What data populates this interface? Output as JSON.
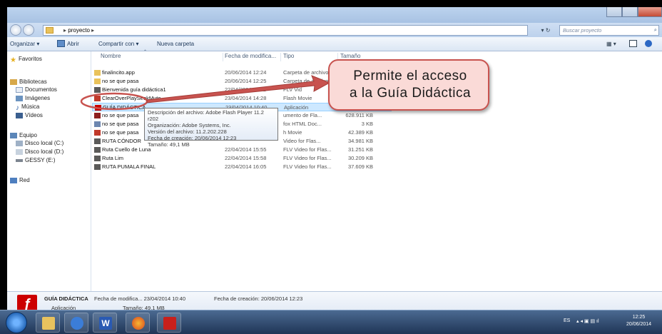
{
  "window": {
    "address_path": [
      "proyecto"
    ],
    "search_placeholder": "Buscar proyecto",
    "toolbar": {
      "organize": "Organizar ▾",
      "open": "Abrir",
      "share": "Compartir con ▾",
      "new_folder": "Nueva carpeta"
    }
  },
  "nav": {
    "favorites": "Favoritos",
    "libraries": "Bibliotecas",
    "documents": "Documentos",
    "images": "Imágenes",
    "music": "Música",
    "videos": "Vídeos",
    "computer": "Equipo",
    "disk_c": "Disco local (C:)",
    "disk_d": "Disco local (D:)",
    "gessy": "GESSY (E:)",
    "network": "Red"
  },
  "columns": {
    "name": "Nombre",
    "date": "Fecha de modifica...",
    "type": "Tipo",
    "size": "Tamaño"
  },
  "files": [
    {
      "name": "finalincito.app",
      "date": "20/06/2014 12:24",
      "type": "Carpeta de archivos",
      "size": "",
      "icon": "folder-icon"
    },
    {
      "name": "no se que pasa",
      "date": "20/06/2014 12:25",
      "type": "Carpeta de archivos",
      "size": "",
      "icon": "folder-icon"
    },
    {
      "name": "Bienvenida guía didáctica1",
      "date": "22/04/2014 11:12",
      "type": "FLV Vid",
      "size": "",
      "icon": "video-file-icon"
    },
    {
      "name": "ClearOverPlaySeekMute",
      "date": "23/04/2014 14:28",
      "type": "Flash Movie",
      "size": "",
      "icon": "flash-movie-icon"
    },
    {
      "name": "GUÍA DIDÁCTICA",
      "date": "23/04/2014 10:40",
      "type": "Aplicación",
      "size": "",
      "icon": "flash-app-icon"
    },
    {
      "name": "no se que pasa",
      "date": "",
      "type": "umento de Fla...",
      "size": "628.911 KB",
      "icon": "flash-doc-icon"
    },
    {
      "name": "no se que pasa",
      "date": "",
      "type": "fox HTML Doc...",
      "size": "3 KB",
      "icon": "html-file-icon"
    },
    {
      "name": "no se que pasa",
      "date": "",
      "type": "h Movie",
      "size": "42.389 KB",
      "icon": "flash-movie-icon"
    },
    {
      "name": "RUTA CÓNDOR",
      "date": "",
      "type": "Video for Flas...",
      "size": "34.981 KB",
      "icon": "video-file-icon"
    },
    {
      "name": "Ruta Cuello de Luna",
      "date": "22/04/2014 15:55",
      "type": "FLV Video for Flas...",
      "size": "31.251 KB",
      "icon": "video-file-icon"
    },
    {
      "name": "Ruta Lim",
      "date": "22/04/2014 15:58",
      "type": "FLV Video for Flas...",
      "size": "30.209 KB",
      "icon": "video-file-icon"
    },
    {
      "name": "RUTA PUMALA FINAL",
      "date": "22/04/2014 16:05",
      "type": "FLV Video for Flas...",
      "size": "37.609 KB",
      "icon": "video-file-icon"
    }
  ],
  "tooltip": {
    "line1": "Descripción del archivo: Adobe Flash Player 11.2 r202",
    "line2": "Organización: Adobe Systems, Inc.",
    "line3": "Versión del archivo: 11.2.202.228",
    "line4": "Fecha de creación: 20/06/2014 12:23",
    "line5": "Tamaño: 49,1 MB"
  },
  "callout": {
    "line1": "Permite el acceso",
    "line2": "a la Guía Didáctica"
  },
  "details": {
    "name": "GUÍA DIDÁCTICA",
    "modified": "Fecha de modifica... 23/04/2014 10:40",
    "created": "Fecha de creación: 20/06/2014 12:23",
    "type": "Aplicación",
    "size": "Tamaño: 49,1 MB"
  },
  "taskbar": {
    "lang": "ES",
    "time": "12:25",
    "date": "20/06/2014"
  },
  "colors": {
    "accent": "#c8534f",
    "selection": "#cde8ff"
  }
}
